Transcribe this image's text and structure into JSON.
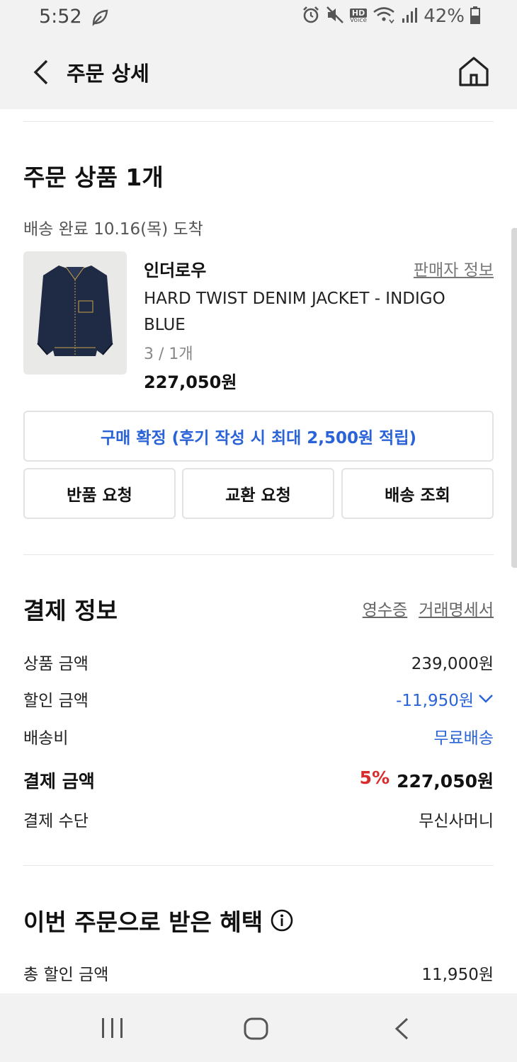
{
  "status_bar": {
    "time": "5:52",
    "battery": "42%",
    "hd_top": "HD",
    "hd_bottom": "Voice"
  },
  "header": {
    "title": "주문 상세"
  },
  "order": {
    "section_title": "주문 상품 1개",
    "delivery_status": "배송 완료 10.16(목) 도착",
    "product": {
      "brand": "인더로우",
      "seller_info_label": "판매자 정보",
      "name": "HARD TWIST DENIM JACKET - INDIGO BLUE",
      "option": "3 / 1개",
      "price": "227,050원"
    },
    "confirm_label": "구매 확정 (후기 작성 시 최대 2,500원 적립)",
    "actions": {
      "return_label": "반품 요청",
      "exchange_label": "교환 요청",
      "tracking_label": "배송 조회"
    }
  },
  "payment": {
    "section_title": "결제 정보",
    "receipt_label": "영수증",
    "statement_label": "거래명세서",
    "product_amount_label": "상품 금액",
    "product_amount": "239,000원",
    "discount_label": "할인 금액",
    "discount": "-11,950원",
    "shipping_label": "배송비",
    "shipping": "무료배송",
    "total_label": "결제 금액",
    "total_rate": "5%",
    "total": "227,050원",
    "method_label": "결제 수단",
    "method": "무신사머니"
  },
  "benefits": {
    "section_title": "이번 주문으로 받은 혜택",
    "total_discount_label": "총 할인 금액",
    "total_discount": "11,950원"
  },
  "colors": {
    "accent_blue": "#2a63d8",
    "accent_red": "#d92b2b",
    "bar_bg": "#f2f2f2"
  }
}
